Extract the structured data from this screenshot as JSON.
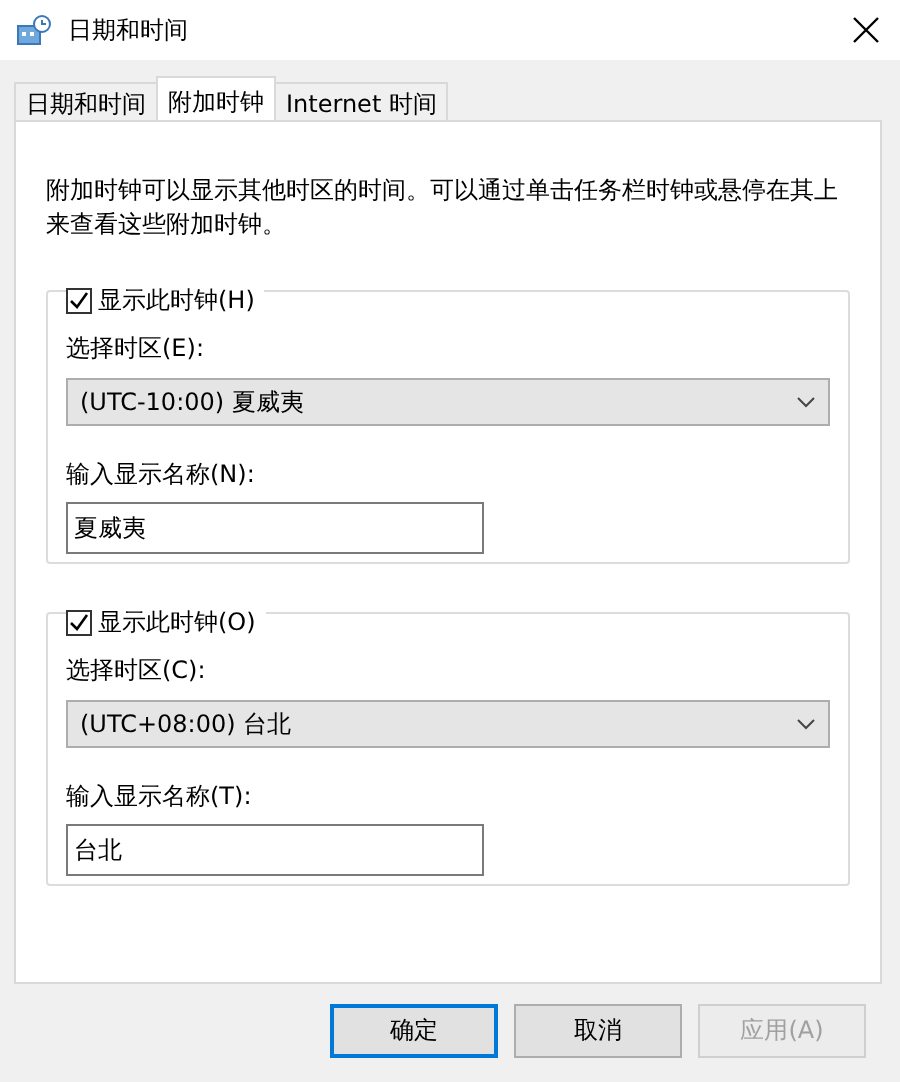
{
  "window": {
    "title": "日期和时间"
  },
  "tabs": [
    {
      "label": "日期和时间",
      "selected": false
    },
    {
      "label": "附加时钟",
      "selected": true
    },
    {
      "label": "Internet 时间",
      "selected": false
    }
  ],
  "description": "附加时钟可以显示其他时区的时间。可以通过单击任务栏时钟或悬停在其上来查看这些附加时钟。",
  "clocks": [
    {
      "show_label": "显示此时钟(H)",
      "checked": true,
      "zone_label": "选择时区(E):",
      "zone": "(UTC-10:00) 夏威夷",
      "name_label": "输入显示名称(N):",
      "name": "夏威夷"
    },
    {
      "show_label": "显示此时钟(O)",
      "checked": true,
      "zone_label": "选择时区(C):",
      "zone": "(UTC+08:00) 台北",
      "name_label": "输入显示名称(T):",
      "name": "台北"
    }
  ],
  "buttons": [
    {
      "label": "确定",
      "default": true,
      "disabled": false
    },
    {
      "label": "取消",
      "default": false,
      "disabled": false
    },
    {
      "label": "应用(A)",
      "default": false,
      "disabled": true
    }
  ]
}
